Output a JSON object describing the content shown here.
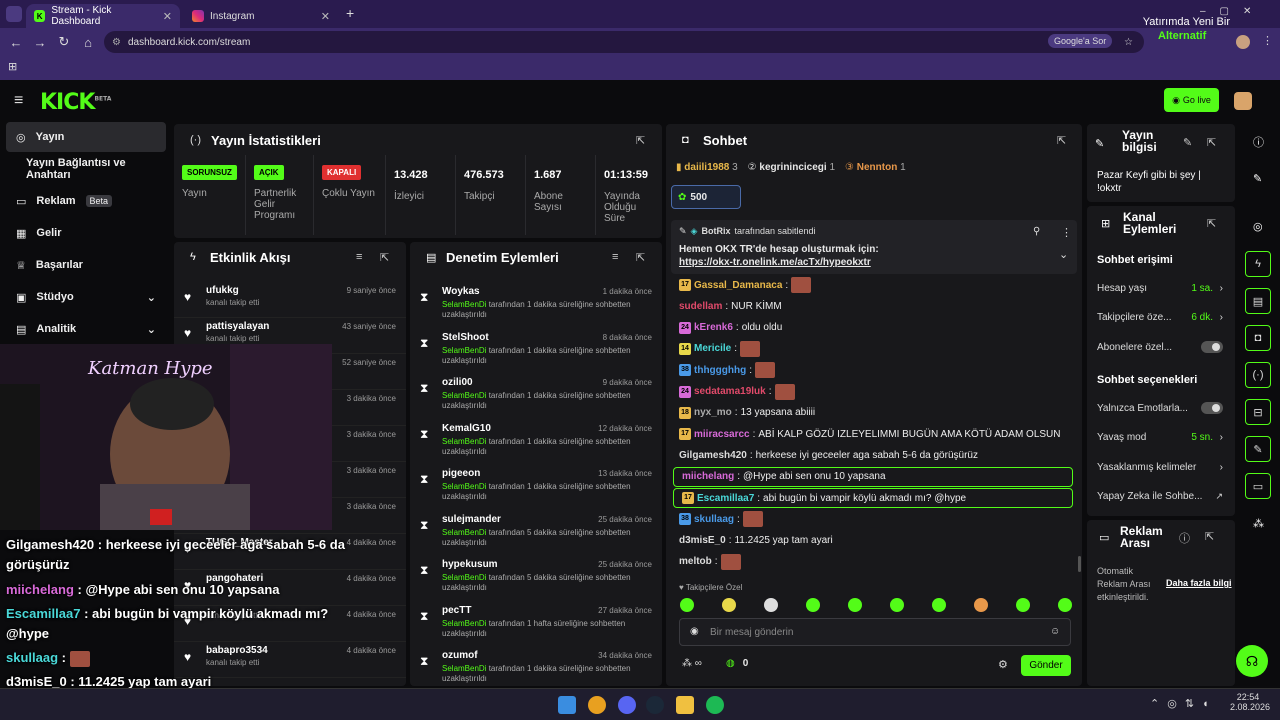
{
  "browser": {
    "tabs": [
      {
        "title": "Stream - Kick Dashboard",
        "active": true
      },
      {
        "title": "Instagram",
        "active": false
      }
    ],
    "url": "dashboard.kick.com/stream",
    "google_btn": "Google'a Sor"
  },
  "overlay_notice": {
    "line1": "Yatırımda Yeni Bir",
    "line2": "Alternatif"
  },
  "header": {
    "logo": "KICK",
    "logo_sup": "BETA",
    "go_live": "Go live"
  },
  "sidebar": {
    "items": [
      {
        "label": "Yayın",
        "icon": "broadcast-icon"
      },
      {
        "label": "Yayın Bağlantısı ve Anahtarı",
        "icon": ""
      },
      {
        "label": "Reklam",
        "badge": "Beta",
        "icon": "ad-icon"
      },
      {
        "label": "Gelir",
        "icon": "chart-icon"
      },
      {
        "label": "Başarılar",
        "icon": "trophy-icon"
      },
      {
        "label": "Stüdyo",
        "icon": "studio-icon"
      },
      {
        "label": "Analitik",
        "icon": "analytics-icon"
      }
    ]
  },
  "stats": {
    "title": "Yayın İstatistikleri",
    "items": [
      {
        "badge": "SORUNSUZ",
        "label": "Yayın",
        "badge_color": "#53fc18"
      },
      {
        "badge": "AÇIK",
        "label": "Partnerlik Gelir Programı",
        "badge_color": "#53fc18"
      },
      {
        "badge": "KAPALI",
        "label": "Çoklu Yayın",
        "badge_color": "#e03030"
      },
      {
        "value": "13.428",
        "label": "İzleyici"
      },
      {
        "value": "476.573",
        "label": "Takipçi"
      },
      {
        "value": "1.687",
        "label": "Abone Sayısı"
      },
      {
        "value": "01:13:59",
        "label": "Yayında Olduğu Süre"
      }
    ]
  },
  "activity": {
    "title": "Etkinlik Akışı",
    "rows": [
      {
        "name": "ufukkg",
        "sub": "kanalı takip etti",
        "time": "9 saniye önce"
      },
      {
        "name": "pattisyalayan",
        "sub": "kanalı takip etti",
        "time": "43 saniye önce"
      },
      {
        "name": "",
        "sub": "",
        "time": "52 saniye önce"
      },
      {
        "name": "",
        "sub": "",
        "time": "3 dakika önce"
      },
      {
        "name": "",
        "sub": "",
        "time": "3 dakika önce"
      },
      {
        "name": "",
        "sub": "",
        "time": "3 dakika önce"
      },
      {
        "name": "",
        "sub": "",
        "time": "3 dakika önce"
      },
      {
        "name": "TUGO_Master",
        "sub": "",
        "time": "4 dakika önce"
      },
      {
        "name": "pangohateri",
        "sub": "",
        "time": "4 dakika önce"
      },
      {
        "name": "",
        "sub": "kanalı takip etti",
        "time": "4 dakika önce"
      },
      {
        "name": "babapro3534",
        "sub": "kanalı takip etti",
        "time": "4 dakika önce"
      }
    ]
  },
  "moderation": {
    "title": "Denetim Eylemleri",
    "by": "SelamBenDi",
    "rows": [
      {
        "name": "Woykas",
        "time": "1 dakika önce",
        "text": "tarafından 1 dakika süreliğine sohbetten uzaklaştırıldı"
      },
      {
        "name": "StelShoot",
        "time": "8 dakika önce",
        "text": "tarafından 1 dakika süreliğine sohbetten uzaklaştırıldı"
      },
      {
        "name": "ozili00",
        "time": "9 dakika önce",
        "text": "tarafından 1 dakika süreliğine sohbetten uzaklaştırıldı"
      },
      {
        "name": "KemalG10",
        "time": "12 dakika önce",
        "text": "tarafından 1 dakika süreliğine sohbetten uzaklaştırıldı"
      },
      {
        "name": "pigeeon",
        "time": "13 dakika önce",
        "text": "tarafından 1 dakika süreliğine sohbetten uzaklaştırıldı"
      },
      {
        "name": "sulejmander",
        "time": "25 dakika önce",
        "text": "tarafından 5 dakika süreliğine sohbetten uzaklaştırıldı"
      },
      {
        "name": "hypekusum",
        "time": "25 dakika önce",
        "text": "tarafından 5 dakika süreliğine sohbetten uzaklaştırıldı"
      },
      {
        "name": "pecTT",
        "time": "27 dakika önce",
        "text": "tarafından 1 hafta süreliğine sohbetten uzaklaştırıldı"
      },
      {
        "name": "ozumof",
        "time": "34 dakika önce",
        "text": "tarafından 1 dakika süreliğine sohbetten uzaklaştırıldı"
      }
    ]
  },
  "chat": {
    "title": "Sohbet",
    "leaders": [
      {
        "name": "daiili1988",
        "count": "3",
        "color": "#e8b84a"
      },
      {
        "name": "kegrinincicegi",
        "count": "1",
        "color": "#ddd"
      },
      {
        "name": "Nennton",
        "count": "1",
        "color": "#e8984a"
      }
    ],
    "gift_count": "500",
    "pinned": {
      "by": "BotRix",
      "by_text": "tarafından sabitlendi",
      "text": "Hemen OKX TR'de hesap oluşturmak için:",
      "link": "https://okx-tr.onelink.me/acTx/hypeokxtr"
    },
    "messages": [
      {
        "badge": "17",
        "user": "Gassal_Damanaca",
        "color": "#e8b84a",
        "text": "",
        "emote": true
      },
      {
        "badge": "",
        "user": "sudellam",
        "color": "#e04a6a",
        "text": "NUR KİMM"
      },
      {
        "badge": "24",
        "user": "kErenk6",
        "color": "#d86ad8",
        "text": "oldu oldu"
      },
      {
        "badge": "14",
        "user": "Mericile",
        "color": "#4ad8d8",
        "text": "",
        "emote": true
      },
      {
        "badge": "38",
        "user": "thhggghhg",
        "color": "#4a9ae8",
        "text": "",
        "emote": true
      },
      {
        "badge": "24",
        "user": "sedatama19luk",
        "color": "#e04a6a",
        "text": "",
        "emote": true
      },
      {
        "badge": "18",
        "user": "nyx_mo",
        "color": "#aaa",
        "text": "13 yapsana abiiii"
      },
      {
        "badge": "17",
        "user": "miiracsarcc",
        "color": "#d86ad8",
        "text": "ABİ KALP GÖZÜ IZLEYELIMMI BUGÜN AMA KÖTÜ ADAM OLSUN"
      },
      {
        "badge": "",
        "user": "Gilgamesh420",
        "color": "#ddd",
        "text": "herkeese iyi geceeler aga sabah 5-6 da görüşürüz"
      },
      {
        "badge": "",
        "user": "miichelang",
        "color": "#d86ad8",
        "text": "@Hype abi sen onu 10 yapsana",
        "highlight": true
      },
      {
        "badge": "17",
        "user": "Escamillaa7",
        "color": "#4ad8d8",
        "text": "abi bugün bi vampir köylü akmadı mı? @hype",
        "highlight": true
      },
      {
        "badge": "38",
        "user": "skullaag",
        "color": "#4a9ae8",
        "text": "",
        "emote": true
      },
      {
        "badge": "",
        "user": "d3misE_0",
        "color": "#ddd",
        "text": "11.2425 yap tam ayari"
      },
      {
        "badge": "",
        "user": "meltob",
        "color": "#ddd",
        "text": "",
        "emote": true
      }
    ],
    "followers_only": "Takipçilere Özel",
    "input_placeholder": "Bir mesaj gönderin",
    "points": "0",
    "send": "Gönder"
  },
  "stream_info": {
    "title": "Yayın bilgisi",
    "text": "Pazar Keyfi gibi bi şey | !okxtr"
  },
  "channel_actions": {
    "title": "Kanal Eylemleri",
    "chat_access": "Sohbet erişimi",
    "rows": [
      {
        "label": "Hesap yaşı",
        "value": "1 sa.",
        "type": "chevron"
      },
      {
        "label": "Takipçilere öze...",
        "value": "6 dk.",
        "type": "chevron"
      },
      {
        "label": "Abonelere özel...",
        "value": "",
        "type": "toggle"
      }
    ],
    "chat_options": "Sohbet seçenekleri",
    "option_rows": [
      {
        "label": "Yalnızca Emotlarla...",
        "value": "",
        "type": "toggle"
      },
      {
        "label": "Yavaş mod",
        "value": "5 sn.",
        "type": "chevron"
      },
      {
        "label": "Yasaklanmış kelimeler",
        "value": "",
        "type": "chevron"
      },
      {
        "label": "Yapay Zeka ile Sohbe...",
        "value": "",
        "type": "external"
      }
    ]
  },
  "ad_break": {
    "title": "Reklam Arası",
    "text": "Otomatik Reklam Arası etkinleştirildi.",
    "link": "Daha fazla bilgi"
  },
  "overlay_chat": [
    {
      "user": "Gilgamesh420",
      "color": "#ffffff",
      "text": ": herkeese iyi geceeler aga sabah 5-6 da görüşürüz"
    },
    {
      "user": "miichelang",
      "color": "#d86ad8",
      "text": ": @Hype abi sen onu 10 yapsana"
    },
    {
      "user": "Escamillaa7",
      "color": "#4ad8d8",
      "text": ": abi bugün bi vampir köylü akmadı mı? @hype"
    },
    {
      "user": "skullaag",
      "color": "#4ad8d8",
      "text": ":"
    },
    {
      "user": "d3misE_0",
      "color": "#ffffff",
      "text": ": 11.2425 yap tam ayari"
    },
    {
      "user": "meltob",
      "color": "#ffffff",
      "text": ":"
    }
  ],
  "webcam_sign": "Katman Hype",
  "taskbar": {
    "time": "22:54",
    "date": "2.08.2026"
  }
}
